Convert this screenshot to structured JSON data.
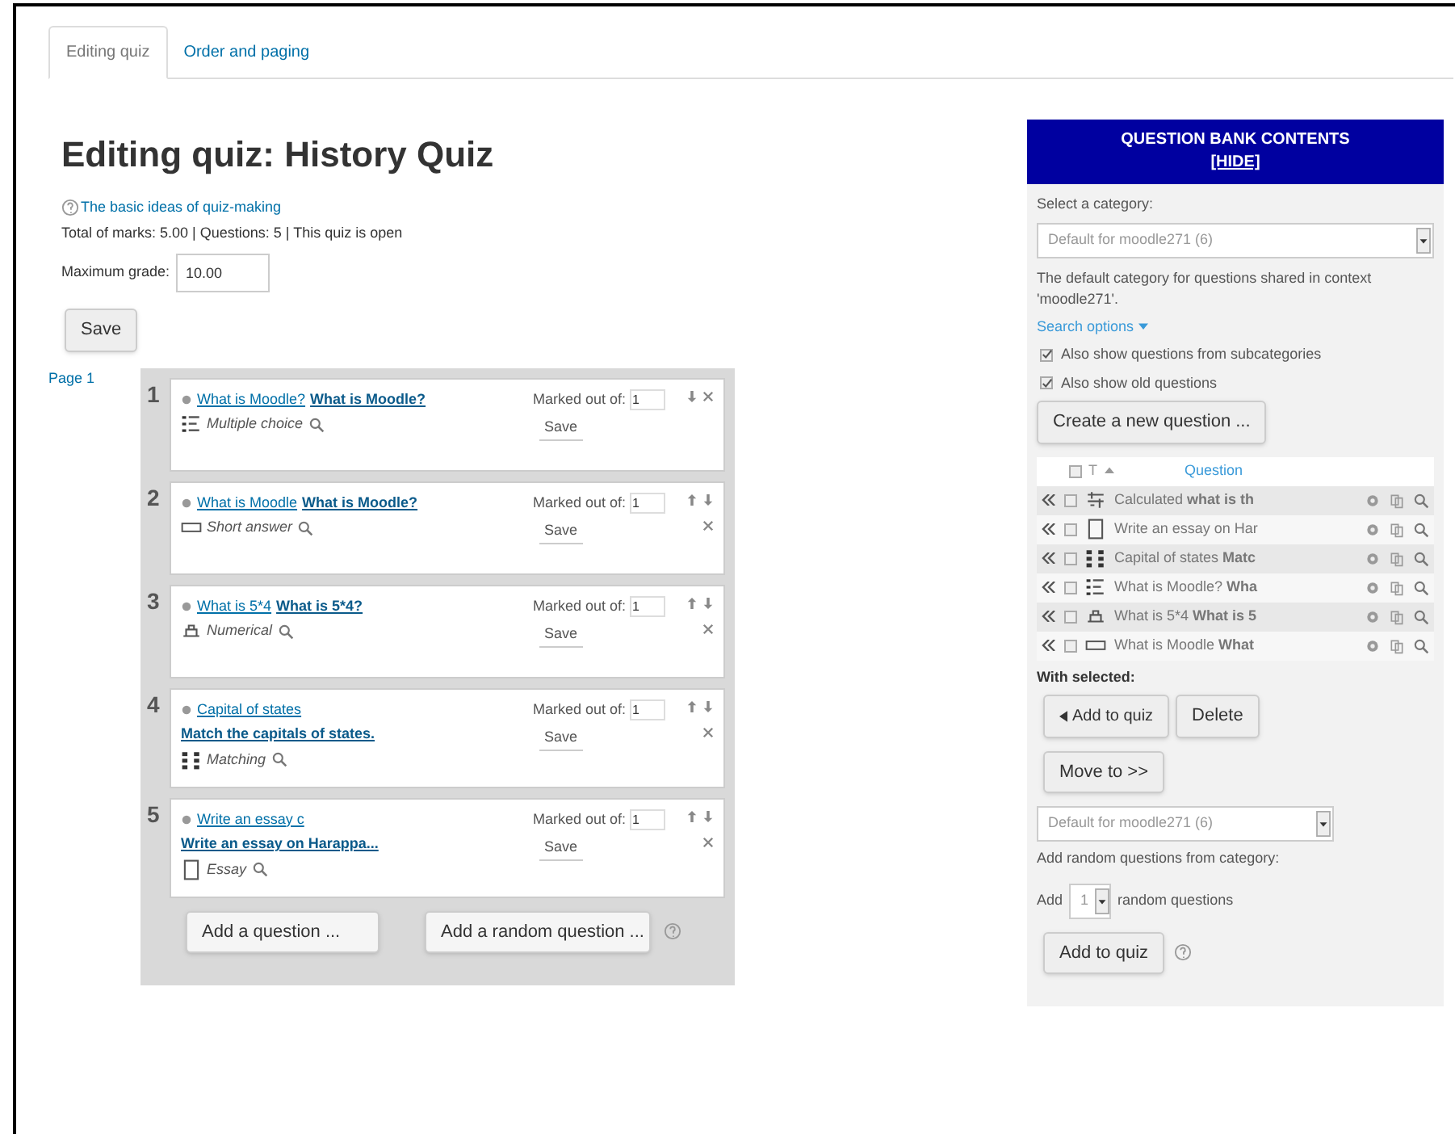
{
  "tabs": [
    {
      "label": "Editing quiz",
      "selected": true
    },
    {
      "label": "Order and paging",
      "selected": false
    }
  ],
  "title": "Editing quiz: History Quiz",
  "help_link": "The basic ideas of quiz-making",
  "summary": "Total of marks: 5.00 | Questions: 5 | This quiz is open",
  "max_grade": {
    "label": "Maximum grade:",
    "value": "10.00"
  },
  "save_button": "Save",
  "page_label": "Page 1",
  "questions": [
    {
      "number": "1",
      "kind": "multichoice",
      "name": "What is Moodle?",
      "text": "What is Moodle?",
      "text_on_new_line": false,
      "type_label": "Multiple choice",
      "marked_label": "Marked out of:",
      "mark": "1",
      "save": "Save",
      "can_move_up": false
    },
    {
      "number": "2",
      "kind": "shortanswer",
      "name": "What is Moodle",
      "text": "What is Moodle?",
      "text_on_new_line": false,
      "type_label": "Short answer",
      "marked_label": "Marked out of:",
      "mark": "1",
      "save": "Save",
      "can_move_up": true
    },
    {
      "number": "3",
      "kind": "numerical",
      "name": "What is 5*4",
      "text": "What is 5*4?",
      "text_on_new_line": false,
      "type_label": "Numerical",
      "marked_label": "Marked out of:",
      "mark": "1",
      "save": "Save",
      "can_move_up": true
    },
    {
      "number": "4",
      "kind": "match",
      "name": "Capital of states",
      "text": "Match the capitals of states.",
      "text_on_new_line": true,
      "type_label": "Matching",
      "marked_label": "Marked out of:",
      "mark": "1",
      "save": "Save",
      "can_move_up": true
    },
    {
      "number": "5",
      "kind": "essay",
      "name": "Write an essay c",
      "text": "Write an essay on Harappa...",
      "text_on_new_line": true,
      "type_label": "Essay",
      "marked_label": "Marked out of:",
      "mark": "1",
      "save": "Save",
      "can_move_up": true
    }
  ],
  "add_question_button": "Add a question ...",
  "add_random_button": "Add a random question ...",
  "bank": {
    "header": "QUESTION BANK CONTENTS",
    "hide_link": "[HIDE]",
    "category_label": "Select a category:",
    "category": "Default for moodle271 (6)",
    "category_info": "The default category for questions shared in context 'moodle271'.",
    "search_options": "Search options",
    "options": [
      {
        "label": "Also show questions from subcategories",
        "checked": true
      },
      {
        "label": "Also show old questions",
        "checked": true
      }
    ],
    "create_button": "Create a new question ...",
    "select_all_checked": false,
    "columns": [
      "T",
      "Question"
    ],
    "rows": [
      {
        "kind": "calculated",
        "text": "Calculated **what is th**",
        "checked": false
      },
      {
        "kind": "essay",
        "text": "Write an essay on Har",
        "checked": false
      },
      {
        "kind": "match",
        "text": "Capital of states **Matc**",
        "checked": false
      },
      {
        "kind": "multichoice",
        "text": "What is Moodle? **Wha**",
        "checked": false
      },
      {
        "kind": "numerical",
        "text": "What is 5*4 **What is 5**",
        "checked": false
      },
      {
        "kind": "shortanswer",
        "text": "What is Moodle **What**",
        "checked": false
      }
    ],
    "with_selected": "With selected:",
    "add_to_quiz": "Add to quiz",
    "delete": "Delete",
    "move_to": "Move to >>",
    "move_category": "Default for moodle271 (6)",
    "random_label": "Add random questions from category:",
    "add_label": "Add",
    "random_count": "1",
    "random_suffix": "random questions",
    "add_random_to_quiz": "Add to quiz"
  }
}
